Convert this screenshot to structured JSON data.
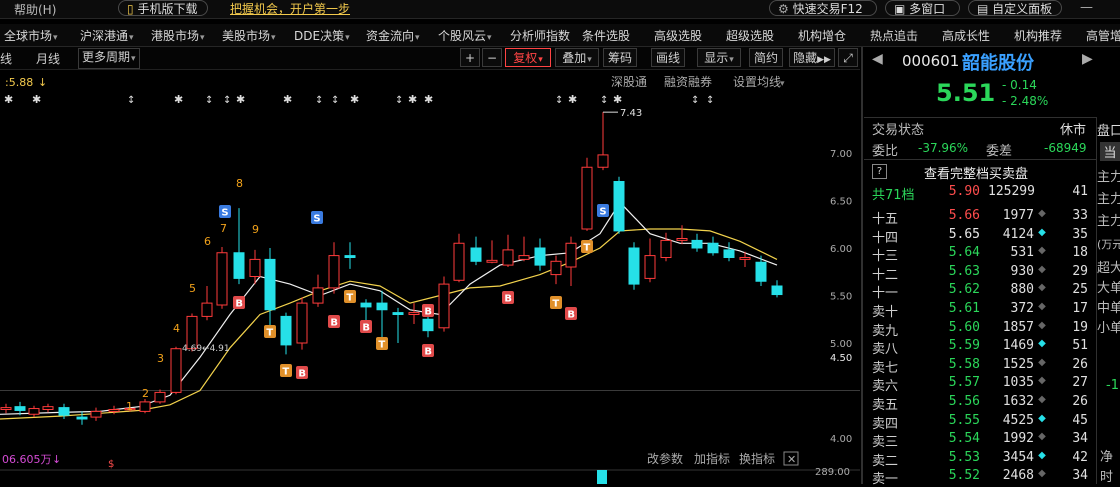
{
  "topbar": {
    "help": "帮助(H)",
    "mobile_download": "手机版下载",
    "promo": "把握机会，开户第一步",
    "quick_trade": "快速交易F12",
    "multi_window": "多窗口",
    "custom_panel": "自定义面板"
  },
  "menu": [
    "全球市场",
    "沪深港通",
    "港股市场",
    "美股市场",
    "DDE决策",
    "资金流向",
    "个股风云",
    "分析师指数",
    "条件选股",
    "高级选股",
    "超级选股",
    "机构增仓",
    "热点追击",
    "高成长性",
    "机构推荐",
    "高管增"
  ],
  "toolbar": {
    "left": [
      "线",
      "月线",
      "更多周期"
    ],
    "plus": "+",
    "minus": "−",
    "adjust": "复权",
    "overlay": "叠加",
    "chips": "筹码",
    "draw": "画线",
    "display": "显示",
    "simple": "简约",
    "hide": "隐藏",
    "links": [
      "深股通",
      "融资融券",
      "设置均线"
    ]
  },
  "chart": {
    "ma_label": ":5.88",
    "max_label": "7.43",
    "min_label": "4.69←4.91",
    "current_price_tag": "4.50",
    "yticks": [
      {
        "v": 7.0,
        "t": "7.00"
      },
      {
        "v": 6.5,
        "t": "6.50"
      },
      {
        "v": 6.0,
        "t": "6.00"
      },
      {
        "v": 5.5,
        "t": "5.50"
      },
      {
        "v": 5.0,
        "t": "5.00"
      },
      {
        "v": 4.0,
        "t": "4.00"
      }
    ],
    "volume_label": "06.605万",
    "volume_links": [
      "改参数",
      "加指标",
      "换指标"
    ],
    "volume_tick": "289.00"
  },
  "chart_data": {
    "type": "candlestick",
    "ylim": [
      3.8,
      7.6
    ],
    "candles": [
      {
        "x": 6,
        "o": 4.3,
        "c": 4.32,
        "h": 4.36,
        "l": 4.26
      },
      {
        "x": 20,
        "o": 4.33,
        "c": 4.29,
        "h": 4.38,
        "l": 4.24
      },
      {
        "x": 34,
        "o": 4.25,
        "c": 4.31,
        "h": 4.34,
        "l": 4.22
      },
      {
        "x": 48,
        "o": 4.3,
        "c": 4.33,
        "h": 4.36,
        "l": 4.27
      },
      {
        "x": 64,
        "o": 4.32,
        "c": 4.24,
        "h": 4.36,
        "l": 4.2
      },
      {
        "x": 82,
        "o": 4.22,
        "c": 4.2,
        "h": 4.28,
        "l": 4.14
      },
      {
        "x": 96,
        "o": 4.22,
        "c": 4.28,
        "h": 4.32,
        "l": 4.18
      },
      {
        "x": 114,
        "o": 4.28,
        "c": 4.3,
        "h": 4.34,
        "l": 4.25
      },
      {
        "x": 130,
        "o": 4.3,
        "c": 4.31,
        "h": 4.33,
        "l": 4.28
      },
      {
        "x": 145,
        "o": 4.28,
        "c": 4.38,
        "h": 4.41,
        "l": 4.26
      },
      {
        "x": 160,
        "o": 4.38,
        "c": 4.48,
        "h": 4.51,
        "l": 4.36
      },
      {
        "x": 176,
        "o": 4.48,
        "c": 4.94,
        "h": 4.96,
        "l": 4.46
      },
      {
        "x": 192,
        "o": 4.94,
        "c": 5.28,
        "h": 5.31,
        "l": 4.91
      },
      {
        "x": 207,
        "o": 5.28,
        "c": 5.42,
        "h": 5.6,
        "l": 5.24
      },
      {
        "x": 222,
        "o": 5.4,
        "c": 5.95,
        "h": 6.01,
        "l": 5.36
      },
      {
        "x": 239,
        "o": 5.95,
        "c": 5.68,
        "h": 6.42,
        "l": 5.62
      },
      {
        "x": 255,
        "o": 5.7,
        "c": 5.88,
        "h": 5.98,
        "l": 5.62
      },
      {
        "x": 270,
        "o": 5.88,
        "c": 5.35,
        "h": 6.0,
        "l": 5.15
      },
      {
        "x": 286,
        "o": 5.28,
        "c": 4.98,
        "h": 5.32,
        "l": 4.88
      },
      {
        "x": 302,
        "o": 5.0,
        "c": 5.42,
        "h": 5.48,
        "l": 4.93
      },
      {
        "x": 318,
        "o": 5.42,
        "c": 5.58,
        "h": 5.72,
        "l": 5.38
      },
      {
        "x": 334,
        "o": 5.58,
        "c": 5.92,
        "h": 6.06,
        "l": 5.52
      },
      {
        "x": 350,
        "o": 5.92,
        "c": 5.9,
        "h": 6.06,
        "l": 5.78
      },
      {
        "x": 366,
        "o": 5.42,
        "c": 5.38,
        "h": 5.46,
        "l": 5.12
      },
      {
        "x": 382,
        "o": 5.42,
        "c": 5.35,
        "h": 5.55,
        "l": 5.02
      },
      {
        "x": 398,
        "o": 5.32,
        "c": 5.3,
        "h": 5.37,
        "l": 5.0
      },
      {
        "x": 414,
        "o": 5.3,
        "c": 5.32,
        "h": 5.42,
        "l": 5.2
      },
      {
        "x": 428,
        "o": 5.25,
        "c": 5.13,
        "h": 5.32,
        "l": 5.06
      },
      {
        "x": 444,
        "o": 5.16,
        "c": 5.62,
        "h": 5.7,
        "l": 5.12
      },
      {
        "x": 459,
        "o": 5.66,
        "c": 6.05,
        "h": 6.15,
        "l": 5.64
      },
      {
        "x": 476,
        "o": 6.0,
        "c": 5.86,
        "h": 6.12,
        "l": 5.82
      },
      {
        "x": 492,
        "o": 5.85,
        "c": 5.87,
        "h": 6.08,
        "l": 5.84
      },
      {
        "x": 508,
        "o": 5.82,
        "c": 5.98,
        "h": 6.14,
        "l": 5.8
      },
      {
        "x": 524,
        "o": 5.88,
        "c": 5.92,
        "h": 6.12,
        "l": 5.86
      },
      {
        "x": 540,
        "o": 6.0,
        "c": 5.82,
        "h": 6.1,
        "l": 5.76
      },
      {
        "x": 556,
        "o": 5.72,
        "c": 5.86,
        "h": 5.92,
        "l": 5.62
      },
      {
        "x": 571,
        "o": 5.8,
        "c": 6.05,
        "h": 6.12,
        "l": 5.6
      },
      {
        "x": 587,
        "o": 6.2,
        "c": 6.85,
        "h": 6.95,
        "l": 6.18
      },
      {
        "x": 603,
        "o": 6.85,
        "c": 6.98,
        "h": 7.43,
        "l": 6.82
      },
      {
        "x": 619,
        "o": 6.7,
        "c": 6.18,
        "h": 6.75,
        "l": 6.15
      },
      {
        "x": 634,
        "o": 6.0,
        "c": 5.62,
        "h": 6.06,
        "l": 5.56
      },
      {
        "x": 650,
        "o": 5.68,
        "c": 5.92,
        "h": 6.1,
        "l": 5.64
      },
      {
        "x": 666,
        "o": 5.9,
        "c": 6.08,
        "h": 6.16,
        "l": 5.86
      },
      {
        "x": 682,
        "o": 6.08,
        "c": 6.1,
        "h": 6.24,
        "l": 6.04
      },
      {
        "x": 697,
        "o": 6.08,
        "c": 6.0,
        "h": 6.15,
        "l": 5.96
      },
      {
        "x": 713,
        "o": 6.05,
        "c": 5.95,
        "h": 6.12,
        "l": 5.92
      },
      {
        "x": 729,
        "o": 5.98,
        "c": 5.9,
        "h": 6.06,
        "l": 5.86
      },
      {
        "x": 745,
        "o": 5.88,
        "c": 5.9,
        "h": 5.96,
        "l": 5.8
      },
      {
        "x": 761,
        "o": 5.85,
        "c": 5.65,
        "h": 5.92,
        "l": 5.6
      },
      {
        "x": 777,
        "o": 5.6,
        "c": 5.51,
        "h": 5.66,
        "l": 5.48
      }
    ],
    "ma_white": [
      [
        0,
        4.25
      ],
      [
        60,
        4.27
      ],
      [
        100,
        4.28
      ],
      [
        140,
        4.33
      ],
      [
        170,
        4.45
      ],
      [
        200,
        4.85
      ],
      [
        230,
        5.3
      ],
      [
        260,
        5.7
      ],
      [
        290,
        5.62
      ],
      [
        320,
        5.5
      ],
      [
        350,
        5.62
      ],
      [
        380,
        5.55
      ],
      [
        410,
        5.35
      ],
      [
        440,
        5.3
      ],
      [
        470,
        5.62
      ],
      [
        500,
        5.82
      ],
      [
        540,
        5.92
      ],
      [
        570,
        5.95
      ],
      [
        600,
        6.15
      ],
      [
        620,
        6.48
      ],
      [
        650,
        6.15
      ],
      [
        680,
        6.05
      ],
      [
        710,
        6.05
      ],
      [
        740,
        5.97
      ],
      [
        777,
        5.82
      ]
    ],
    "ma_yellow": [
      [
        0,
        4.2
      ],
      [
        60,
        4.23
      ],
      [
        100,
        4.26
      ],
      [
        140,
        4.29
      ],
      [
        170,
        4.35
      ],
      [
        200,
        4.5
      ],
      [
        230,
        4.95
      ],
      [
        260,
        5.3
      ],
      [
        290,
        5.42
      ],
      [
        320,
        5.55
      ],
      [
        350,
        5.65
      ],
      [
        380,
        5.6
      ],
      [
        410,
        5.42
      ],
      [
        440,
        5.5
      ],
      [
        470,
        5.58
      ],
      [
        500,
        5.6
      ],
      [
        540,
        5.72
      ],
      [
        570,
        5.85
      ],
      [
        600,
        6.0
      ],
      [
        620,
        6.18
      ],
      [
        650,
        6.2
      ],
      [
        680,
        6.2
      ],
      [
        710,
        6.18
      ],
      [
        740,
        6.07
      ],
      [
        777,
        5.88
      ]
    ]
  },
  "stock": {
    "code": "000601",
    "name": "韶能股份",
    "price": "5.51",
    "change": "- 0.14",
    "change_pct": "- 2.48%",
    "status_label": "交易状态",
    "status": "休市",
    "weibi_label": "委比",
    "weibi": "-37.96%",
    "weicha_label": "委差",
    "weicha": "-68949",
    "view_full": "查看完整档买卖盘",
    "question": "?",
    "total_label": "共71档",
    "total_price": "5.90",
    "total_vol": "125299",
    "total_cnt": "41"
  },
  "orderbook": [
    {
      "label": "十五",
      "price": "5.66",
      "vol": "1977",
      "dot": "◆",
      "cnt": "33",
      "pc": "red",
      "dc": "gray"
    },
    {
      "label": "十四",
      "price": "5.65",
      "vol": "4124",
      "dot": "◆",
      "cnt": "35",
      "pc": "white",
      "dc": "cyan"
    },
    {
      "label": "十三",
      "price": "5.64",
      "vol": "531",
      "dot": "◆",
      "cnt": "18",
      "pc": "green",
      "dc": "gray"
    },
    {
      "label": "十二",
      "price": "5.63",
      "vol": "930",
      "dot": "◆",
      "cnt": "29",
      "pc": "green",
      "dc": "gray"
    },
    {
      "label": "十一",
      "price": "5.62",
      "vol": "880",
      "dot": "◆",
      "cnt": "25",
      "pc": "green",
      "dc": "gray"
    },
    {
      "label": "卖十",
      "price": "5.61",
      "vol": "372",
      "dot": "◆",
      "cnt": "17",
      "pc": "green",
      "dc": "gray"
    },
    {
      "label": "卖九",
      "price": "5.60",
      "vol": "1857",
      "dot": "◆",
      "cnt": "19",
      "pc": "green",
      "dc": "gray"
    },
    {
      "label": "卖八",
      "price": "5.59",
      "vol": "1469",
      "dot": "◆",
      "cnt": "51",
      "pc": "green",
      "dc": "cyan"
    },
    {
      "label": "卖七",
      "price": "5.58",
      "vol": "1525",
      "dot": "◆",
      "cnt": "26",
      "pc": "green",
      "dc": "gray"
    },
    {
      "label": "卖六",
      "price": "5.57",
      "vol": "1035",
      "dot": "◆",
      "cnt": "27",
      "pc": "green",
      "dc": "gray"
    },
    {
      "label": "卖五",
      "price": "5.56",
      "vol": "1632",
      "dot": "◆",
      "cnt": "26",
      "pc": "green",
      "dc": "gray"
    },
    {
      "label": "卖四",
      "price": "5.55",
      "vol": "4525",
      "dot": "◆",
      "cnt": "45",
      "pc": "green",
      "dc": "cyan"
    },
    {
      "label": "卖三",
      "price": "5.54",
      "vol": "1992",
      "dot": "◆",
      "cnt": "34",
      "pc": "green",
      "dc": "gray"
    },
    {
      "label": "卖二",
      "price": "5.53",
      "vol": "3454",
      "dot": "◆",
      "cnt": "42",
      "pc": "green",
      "dc": "cyan"
    },
    {
      "label": "卖一",
      "price": "5.52",
      "vol": "2468",
      "dot": "◆",
      "cnt": "34",
      "pc": "green",
      "dc": "gray"
    }
  ],
  "side_panel": {
    "tab": "盘口",
    "tab2": "当",
    "items": [
      "主力",
      "主力",
      "主力",
      "(万元",
      "超大",
      "大单",
      "中单",
      "小单",
      "-1",
      "净",
      "时"
    ]
  }
}
